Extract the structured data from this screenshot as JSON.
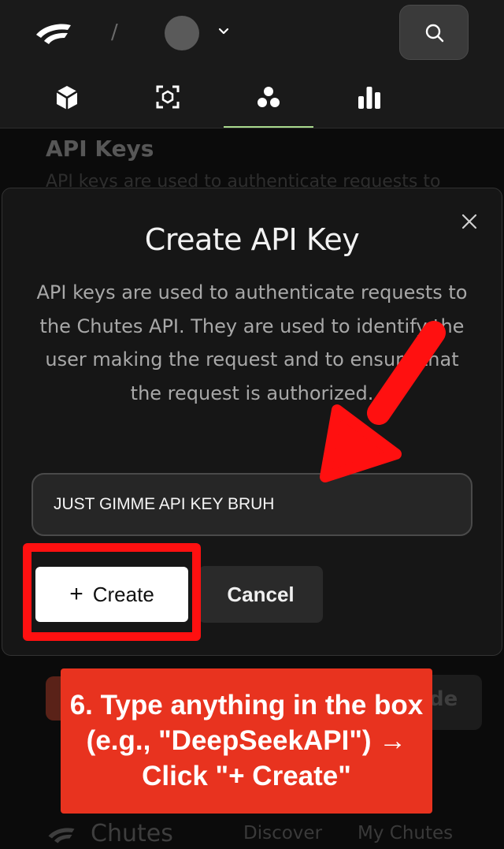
{
  "topbar": {
    "logo_icon": "chutes-logo-icon",
    "breadcrumb_separator": "/",
    "avatar_icon": "avatar-icon",
    "dropdown_icon": "chevron-down-icon",
    "search_icon": "search-icon",
    "nav_tabs": [
      {
        "icon": "cube-icon",
        "active": false
      },
      {
        "icon": "scan-icon",
        "active": false
      },
      {
        "icon": "circles-icon",
        "active": true
      },
      {
        "icon": "bar-chart-icon",
        "active": false
      }
    ],
    "active_tab_color": "#a8d88c"
  },
  "background_page": {
    "title": "API Keys",
    "subtitle": "API keys are used to authenticate requests to",
    "partial_button_text": "de",
    "footer": {
      "brand": "Chutes",
      "links": [
        "Discover",
        "My Chutes"
      ]
    }
  },
  "modal": {
    "title": "Create API Key",
    "description": "API keys are used to authenticate requests to the Chutes API. They are used to identify the user making the request and to ensure that the request is authorized.",
    "input_value": "JUST GIMME API KEY BRUH",
    "create_button": {
      "icon": "+",
      "label": "Create"
    },
    "cancel_button": "Cancel",
    "close_icon": "close-icon"
  },
  "annotation": {
    "callout_text": "6. Type anything in the box (e.g., \"DeepSeekAPI\") → Click \"+ Create\"",
    "color": "#ff1010",
    "callout_color": "#e8331f"
  }
}
